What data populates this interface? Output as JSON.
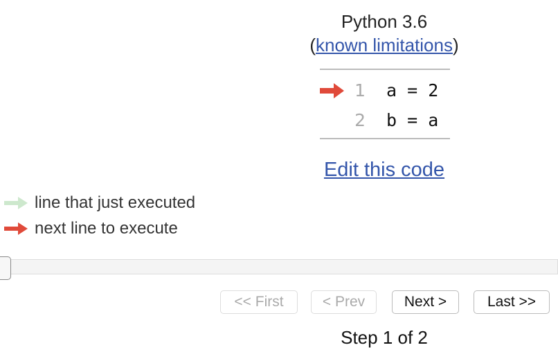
{
  "header": {
    "language": "Python 3.6",
    "limitations_link": "known limitations",
    "open_paren": "(",
    "close_paren": ")"
  },
  "code": {
    "current_line": 1,
    "lines": [
      {
        "number": "1",
        "text": "a = 2"
      },
      {
        "number": "2",
        "text": "b = a"
      }
    ]
  },
  "edit_link": "Edit this code",
  "legend": {
    "executed": "line that just executed",
    "next": "next line to execute"
  },
  "colors": {
    "link": "#3355aa",
    "next_arrow": "#e04a3a",
    "executed_arrow": "#cde8cd",
    "line_number": "#aaaaaa"
  },
  "navigation": {
    "first": "<< First",
    "prev": "< Prev",
    "next": "Next >",
    "last": "Last >>",
    "step_text": "Step 1 of 2",
    "progress": 0
  }
}
